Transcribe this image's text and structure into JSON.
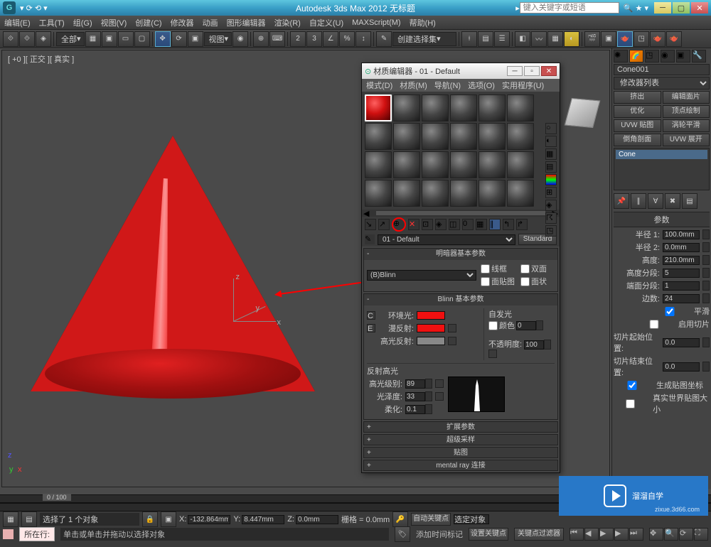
{
  "title": "Autodesk 3ds Max 2012     无标题",
  "search_placeholder": "键入关键字或短语",
  "menubar": [
    "编辑(E)",
    "工具(T)",
    "组(G)",
    "视图(V)",
    "创建(C)",
    "修改器",
    "动画",
    "图形编辑器",
    "渲染(R)",
    "自定义(U)",
    "MAXScript(M)",
    "帮助(H)"
  ],
  "toolbar_combo1": "全部",
  "toolbar_combo2": "视图",
  "toolbar_combo3": "创建选择集",
  "vp_label": "[ +0 ][ 正交 ][ 真实 ]",
  "rp": {
    "obj": "Cone001",
    "modlist": "修改器列表",
    "btns": [
      "挤出",
      "编辑面片",
      "优化",
      "顶点绘制",
      "UVW 贴图",
      "涡轮平滑",
      "倒角剖面",
      "UVW 展开"
    ],
    "stack_item": "Cone",
    "params_title": "参数",
    "radius1_lbl": "半径 1:",
    "radius1": "100.0mm",
    "radius2_lbl": "半径 2:",
    "radius2": "0.0mm",
    "height_lbl": "高度:",
    "height": "210.0mm",
    "hseg_lbl": "高度分段:",
    "hseg": "5",
    "cseg_lbl": "端面分段:",
    "cseg": "1",
    "sides_lbl": "边数:",
    "sides": "24",
    "smooth": "平滑",
    "slice_on": "启用切片",
    "slice_from_lbl": "切片起始位置:",
    "slice_from": "0.0",
    "slice_to_lbl": "切片结束位置:",
    "slice_to": "0.0",
    "gen_map": "生成贴图坐标",
    "real_world": "真实世界贴图大小"
  },
  "dlg": {
    "title": "材质编辑器 - 01 - Default",
    "menus": [
      "模式(D)",
      "材质(M)",
      "导航(N)",
      "选项(O)",
      "实用程序(U)"
    ],
    "mat_name": "01 - Default",
    "mat_type": "Standard",
    "rollout1": "明暗器基本参数",
    "shader": "(B)Blinn",
    "wire": "线框",
    "two_sided": "双面",
    "face_map": "面贴图",
    "faceted": "面状",
    "rollout2": "Blinn 基本参数",
    "ambient": "环境光:",
    "diffuse": "漫反射:",
    "specular_c": "高光反射:",
    "self_illum": "自发光",
    "color_chk": "颜色",
    "self_val": "0",
    "opacity_lbl": "不透明度:",
    "opacity": "100",
    "spec_hdr": "反射高光",
    "spec_level_lbl": "高光级别:",
    "spec_level": "89",
    "gloss_lbl": "光泽度:",
    "gloss": "33",
    "soften_lbl": "柔化:",
    "soften": "0.1",
    "collapsed": [
      "扩展参数",
      "超级采样",
      "贴图",
      "mental ray 连接"
    ]
  },
  "timeline": {
    "frame": "0 / 100"
  },
  "status": {
    "sel": "选择了 1 个对象",
    "x": "-132.864mm",
    "y": "8.447mm",
    "z": "0.0mm",
    "grid": "栅格 = 0.0mm",
    "autokey": "自动关键点",
    "selset": "选定对象",
    "setkey": "设置关键点",
    "keyfilter": "关键点过滤器",
    "now_btn": "所在行:",
    "tip": "单击或单击并拖动以选择对象",
    "addtime": "添加时间标记"
  },
  "watermark": {
    "brand": "溜溜自学",
    "url": "zixue.3d66.com"
  }
}
